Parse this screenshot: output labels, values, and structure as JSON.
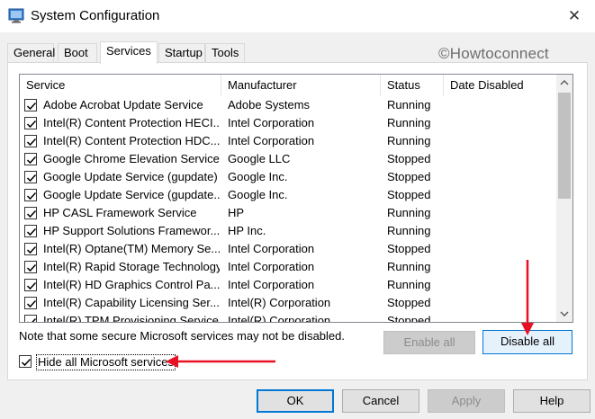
{
  "window": {
    "title": "System Configuration",
    "close_glyph": "✕",
    "icon": "msconfig-icon"
  },
  "watermark": "©Howtoconnect",
  "tabs": [
    {
      "label": "General",
      "active": false
    },
    {
      "label": "Boot",
      "active": false
    },
    {
      "label": "Services",
      "active": true
    },
    {
      "label": "Startup",
      "active": false
    },
    {
      "label": "Tools",
      "active": false
    }
  ],
  "services": {
    "columns": [
      "Service",
      "Manufacturer",
      "Status",
      "Date Disabled"
    ],
    "rows": [
      {
        "name": "Adobe Acrobat Update Service",
        "manufacturer": "Adobe Systems",
        "status": "Running",
        "date_disabled": "",
        "checked": true
      },
      {
        "name": "Intel(R) Content Protection HECI...",
        "manufacturer": "Intel Corporation",
        "status": "Running",
        "date_disabled": "",
        "checked": true
      },
      {
        "name": "Intel(R) Content Protection HDC...",
        "manufacturer": "Intel Corporation",
        "status": "Running",
        "date_disabled": "",
        "checked": true
      },
      {
        "name": "Google Chrome Elevation Service",
        "manufacturer": "Google LLC",
        "status": "Stopped",
        "date_disabled": "",
        "checked": true
      },
      {
        "name": "Google Update Service (gupdate)",
        "manufacturer": "Google Inc.",
        "status": "Stopped",
        "date_disabled": "",
        "checked": true
      },
      {
        "name": "Google Update Service (gupdate...",
        "manufacturer": "Google Inc.",
        "status": "Stopped",
        "date_disabled": "",
        "checked": true
      },
      {
        "name": "HP CASL Framework Service",
        "manufacturer": "HP",
        "status": "Running",
        "date_disabled": "",
        "checked": true
      },
      {
        "name": "HP Support Solutions Framewor...",
        "manufacturer": "HP Inc.",
        "status": "Running",
        "date_disabled": "",
        "checked": true
      },
      {
        "name": "Intel(R) Optane(TM) Memory Se...",
        "manufacturer": "Intel Corporation",
        "status": "Stopped",
        "date_disabled": "",
        "checked": true
      },
      {
        "name": "Intel(R) Rapid Storage Technology",
        "manufacturer": "Intel Corporation",
        "status": "Running",
        "date_disabled": "",
        "checked": true
      },
      {
        "name": "Intel(R) HD Graphics Control Pa...",
        "manufacturer": "Intel Corporation",
        "status": "Running",
        "date_disabled": "",
        "checked": true
      },
      {
        "name": "Intel(R) Capability Licensing Ser...",
        "manufacturer": "Intel(R) Corporation",
        "status": "Stopped",
        "date_disabled": "",
        "checked": true
      },
      {
        "name": "Intel(R) TPM Provisioning Service",
        "manufacturer": "Intel(R) Corporation",
        "status": "Stopped",
        "date_disabled": "",
        "checked": true
      }
    ]
  },
  "note": "Note that some secure Microsoft services may not be disabled.",
  "enable_all": {
    "label": "Enable all",
    "enabled": false
  },
  "disable_all": {
    "label": "Disable all",
    "enabled": true
  },
  "hide_ms": {
    "label": "Hide all Microsoft services",
    "checked": true
  },
  "buttons": {
    "ok": "OK",
    "cancel": "Cancel",
    "apply": "Apply",
    "help": "Help"
  },
  "colors": {
    "accent": "#0078d7",
    "annotation_arrow": "#e81123"
  }
}
